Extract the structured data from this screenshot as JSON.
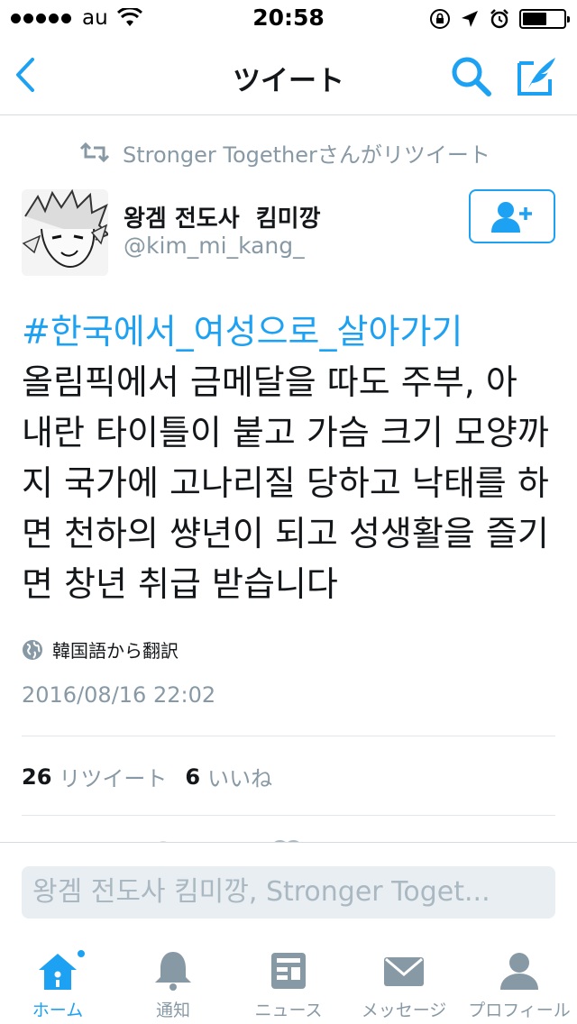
{
  "status_bar": {
    "carrier": "au",
    "time": "20:58",
    "battery_level": 0.6
  },
  "nav": {
    "title": "ツイート",
    "back_icon": "chevron-left-icon",
    "search_icon": "search-icon",
    "compose_icon": "compose-icon"
  },
  "retweet": {
    "text": "Stronger Togetherさんがリツイート"
  },
  "author": {
    "name": "왕겜 전도사  킴미깡",
    "handle": "@kim_mi_kang_"
  },
  "tweet": {
    "hashtag": "#한국에서_여성으로_살아가기",
    "body_lines": [
      "올림픽에서 금메달을 따도 주부, 아",
      "내란 타이틀이 붙고 가슴 크기 모양까",
      "지 국가에 고나리질 당하고 낙태를 하",
      "면 천하의 썅년이 되고 성생활을 즐기",
      "면 창년 취급 받습니다"
    ],
    "translation_note": "韓国語から翻訳",
    "timestamp": "2016/08/16 22:02"
  },
  "stats": {
    "retweets_count": "26",
    "retweets_label": "リツイート",
    "likes_count": "6",
    "likes_label": "いいね"
  },
  "reply": {
    "placeholder": "왕겜 전도사  킴미깡, Stronger Toget..."
  },
  "tabs": [
    {
      "label": "ホーム",
      "icon": "home-icon",
      "active": true
    },
    {
      "label": "通知",
      "icon": "bell-icon",
      "active": false
    },
    {
      "label": "ニュース",
      "icon": "news-icon",
      "active": false
    },
    {
      "label": "メッセージ",
      "icon": "envelope-icon",
      "active": false
    },
    {
      "label": "プロフィール",
      "icon": "person-icon",
      "active": false
    }
  ],
  "colors": {
    "accent": "#1da1f2",
    "secondary_text": "#8899a6",
    "primary_text": "#14171a"
  }
}
